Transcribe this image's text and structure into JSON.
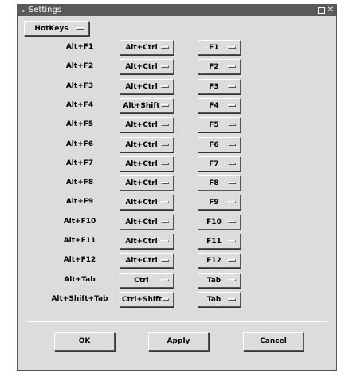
{
  "window": {
    "title": "Settings",
    "menu_icon": "chevron-down-icon",
    "maximize_icon": "maximize-icon",
    "close_icon": "close-icon"
  },
  "category_select": {
    "value": "HotKeys"
  },
  "hotkeys": [
    {
      "label": "Alt+F1",
      "modifier": "Alt+Ctrl",
      "key": "F1"
    },
    {
      "label": "Alt+F2",
      "modifier": "Alt+Ctrl",
      "key": "F2"
    },
    {
      "label": "Alt+F3",
      "modifier": "Alt+Ctrl",
      "key": "F3"
    },
    {
      "label": "Alt+F4",
      "modifier": "Alt+Shift",
      "key": "F4"
    },
    {
      "label": "Alt+F5",
      "modifier": "Alt+Ctrl",
      "key": "F5"
    },
    {
      "label": "Alt+F6",
      "modifier": "Alt+Ctrl",
      "key": "F6"
    },
    {
      "label": "Alt+F7",
      "modifier": "Alt+Ctrl",
      "key": "F7"
    },
    {
      "label": "Alt+F8",
      "modifier": "Alt+Ctrl",
      "key": "F8"
    },
    {
      "label": "Alt+F9",
      "modifier": "Alt+Ctrl",
      "key": "F9"
    },
    {
      "label": "Alt+F10",
      "modifier": "Alt+Ctrl",
      "key": "F10"
    },
    {
      "label": "Alt+F11",
      "modifier": "Alt+Ctrl",
      "key": "F11"
    },
    {
      "label": "Alt+F12",
      "modifier": "Alt+Ctrl",
      "key": "F12"
    },
    {
      "label": "Alt+Tab",
      "modifier": "Ctrl",
      "key": "Tab"
    },
    {
      "label": "Alt+Shift+Tab",
      "modifier": "Ctrl+Shift",
      "key": "Tab"
    }
  ],
  "buttons": {
    "ok": "OK",
    "apply": "Apply",
    "cancel": "Cancel"
  },
  "colors": {
    "titlebar": "#5a5a5a",
    "background": "#dcdcdc"
  }
}
